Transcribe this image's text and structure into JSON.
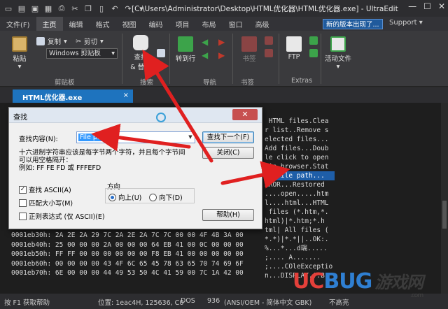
{
  "window": {
    "title": "[C:\\Users\\Administrator\\Desktop\\HTML优化器\\HTML优化器.exe] - UltraEdit",
    "controls": [
      "—",
      "☐",
      "✕"
    ]
  },
  "menu_tabs": [
    "文件(F)",
    "主页",
    "编辑",
    "格式",
    "视图",
    "编码",
    "项目",
    "布局",
    "窗口",
    "高级"
  ],
  "update_badge": "新的版本出现了...",
  "support_label": "Support",
  "ribbon": {
    "paste": "粘贴",
    "copy": "复制",
    "cut": "剪切",
    "clipboard_select": "Windows 剪贴板",
    "clipboard_group": "剪贴板",
    "find_replace": "查找\n& 替换",
    "find_line1": "查找",
    "find_line2": "& 替换",
    "search_group": "搜索",
    "goto": "转到行",
    "nav_group": "导航",
    "bookmarks": "书签",
    "bookmark_group": "书签",
    "ftp": "FTP",
    "extras_group": "Extras",
    "active_files": "活动文件"
  },
  "doc_tab": {
    "label": "HTML优化器.exe",
    "close": "×"
  },
  "editor": {
    "right_lines": [
      " HTML files.Clea",
      "r list..Remove s",
      "elected files...",
      "Add files...Doub",
      "le click to open",
      " in browser.Stat",
      "...File path...",
      "RROR...Restored",
      "....open.....htm",
      "l....html...HTML",
      " files (*.htm,*.",
      "html)|*.htm;*.h",
      "tml| All files (",
      "*.*)|*.*||..OK:.",
      "%...*...d端.....",
      ";.... A.......",
      ";....COleExceptio",
      "n...DISPLAY.!.B."
    ],
    "highlight_index": 6,
    "hex_lines": [
      "0001eb30h: 2A 2E 2A 29 7C 2A 2E 2A 7C 7C 00 00 4F 4B 3A 00",
      "0001eb40h: 25 00 00 00 2A 00 00 00 64 EB 41 00 0C 00 00 00",
      "0001eb50h: FF FF 00 00 00 00 00 00 F8 EB 41 00 00 00 00 00",
      "0001eb60h: 00 00 00 00 43 4F 6C 65 45 78 63 65 70 74 69 6F",
      "0001eb70h: 6E 00 00 00 44 49 53 50 4C 41 59 00 7C 1A 42 00"
    ]
  },
  "status_bar": {
    "help": "按 F1 获取帮助",
    "position": "位置: 1eac4H, 125636, C0",
    "line_ending": "DOS",
    "codepage": "936",
    "encoding": "(ANSI/OEM - 简体中文 GBK)",
    "highlight": "不高亮"
  },
  "find_dialog": {
    "title": "查找",
    "find_label": "查找内容(N):",
    "find_value": "File path",
    "find_next": "查找下一个(F)",
    "close": "关闭(C)",
    "hint_line1": "十六进制字符串应该是每字节两个字符，并且每个字节间",
    "hint_line2": "可以用空格隔开：",
    "hint_line3": "例如: FF FE FD 或 FFFEFD",
    "opt_ascii": "查找 ASCII(A)",
    "opt_ascii_checked": "✓",
    "opt_case": "匹配大小写(M)",
    "opt_regex": "正则表达式 (仅 ASCII)(E)",
    "direction_label": "方向",
    "dir_up": "向上(U)",
    "dir_down": "向下(D)",
    "help": "帮助(H)"
  },
  "watermark": {
    "u": "U",
    "c": "C",
    "bug": "BUG",
    "cn": "游戏网",
    "com": ".com"
  },
  "colors": {
    "accent": "#1e73be",
    "arrow": "#e02020",
    "ribbon_bg": "#3a3a3d",
    "editor_bg": "#1e1e1e"
  }
}
